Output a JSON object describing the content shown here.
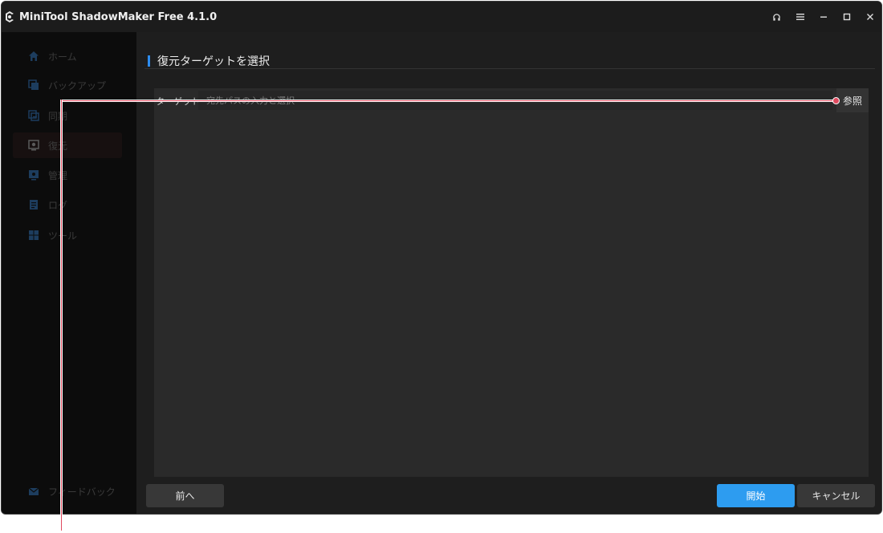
{
  "app": {
    "title": "MiniTool ShadowMaker Free 4.1.0"
  },
  "window_controls": [
    "headset-icon",
    "menu-icon",
    "minimize-icon",
    "maximize-icon",
    "close-icon"
  ],
  "sidebar": {
    "items": [
      {
        "label": "ホーム",
        "icon": "home-icon"
      },
      {
        "label": "バックアップ",
        "icon": "backup-icon"
      },
      {
        "label": "同期",
        "icon": "sync-icon"
      },
      {
        "label": "復元",
        "icon": "restore-icon",
        "active": true
      },
      {
        "label": "管理",
        "icon": "manage-icon"
      },
      {
        "label": "ログ",
        "icon": "log-icon"
      },
      {
        "label": "ツール",
        "icon": "tools-icon"
      }
    ],
    "feedback": {
      "label": "フィードバック",
      "icon": "mail-icon"
    }
  },
  "main": {
    "title": "復元ターゲットを選択",
    "target": {
      "label": "ターゲット",
      "placeholder": "宛先パスの入力と選択",
      "browse_label": "参照"
    },
    "buttons": {
      "prev": "前へ",
      "start": "開始",
      "cancel": "キャンセル"
    }
  },
  "colors": {
    "accent": "#2d9cf0",
    "callout": "#e04a5f"
  }
}
